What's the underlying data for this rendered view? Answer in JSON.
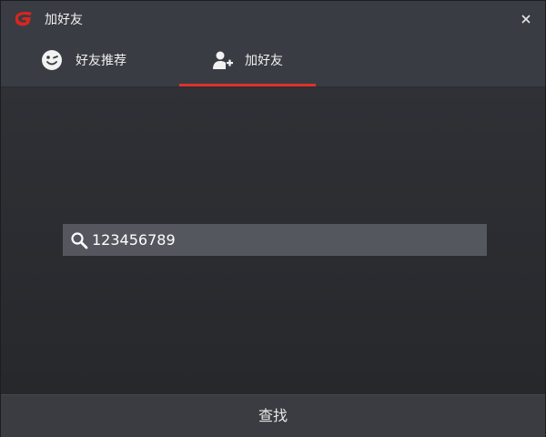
{
  "window": {
    "title": "加好友"
  },
  "tabs": [
    {
      "label": "好友推荐",
      "icon": "smiley-icon",
      "selected": false
    },
    {
      "label": "加好友",
      "icon": "add-user-icon",
      "selected": true
    }
  ],
  "search": {
    "value": "123456789",
    "icon": "search-icon"
  },
  "footer": {
    "find_label": "查找"
  },
  "colors": {
    "accent": "#e0312b",
    "titlebar": "#3a3c43",
    "search_bg": "#55575e"
  }
}
